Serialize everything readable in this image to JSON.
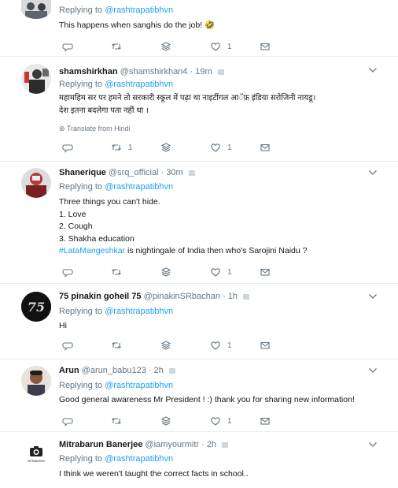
{
  "colors": {
    "accent": "#1da1f2",
    "muted": "#657786",
    "border": "#e6ecf0"
  },
  "tweets": [
    {
      "name": "",
      "handle": "",
      "time": "",
      "reply_prefix": "Replying to",
      "reply_handle": "@rashtrapatibhvn",
      "text": "This happens when sanghis do the job! 🤣",
      "reply_count": "",
      "retweet_count": "",
      "like_count": "1"
    },
    {
      "name": "shamshirkhan",
      "handle": "@shamshirkhan4",
      "time": "19m",
      "reply_prefix": "Replying to",
      "reply_handle": "@rashtrapatibhvn",
      "text_line1": "महामहिम सर पर हमने तो सरकारी स्कूल में पढ़ा था नाइटींगल आॅफ़ इंडिया सरोजिनी नायडू।",
      "text_line2": "देश इतना बदलेगा पता नहीं था ।",
      "translate": "Translate from Hindi",
      "reply_count": "",
      "retweet_count": "1",
      "like_count": "1"
    },
    {
      "name": "Shanerique",
      "handle": "@srq_official",
      "time": "30m",
      "reply_prefix": "Replying to",
      "reply_handle": "@rashtrapatibhvn",
      "lines": [
        "Three things you can't hide.",
        "1. Love",
        "2. Cough",
        "3. Shakha education"
      ],
      "hashtag": "#LataMangeshkar",
      "hashtag_rest": " is nightingale of India then who's Sarojini Naidu ?",
      "reply_count": "",
      "retweet_count": "",
      "like_count": "1"
    },
    {
      "name": "75 pinakin goheil 75",
      "handle": "@pinakinSRbachan",
      "time": "1h",
      "reply_prefix": "Replying to",
      "reply_handle": "@rashtrapatibhvn",
      "text": "Hi",
      "reply_count": "",
      "retweet_count": "",
      "like_count": "1"
    },
    {
      "name": "Arun",
      "handle": "@arun_babu123",
      "time": "2h",
      "reply_prefix": "Replying to",
      "reply_handle": "@rashtrapatibhvn",
      "text": "Good general awareness Mr President ! :) thank you for sharing new information!",
      "reply_count": "",
      "retweet_count": "",
      "like_count": "1"
    },
    {
      "name": "Mitrabarun Banerjee",
      "handle": "@iamyourmitr",
      "time": "2h",
      "reply_prefix": "Replying to",
      "reply_handle": "@rashtrapatibhvn",
      "text": "I think we weren't taught the correct facts in school..",
      "avatar_label": "MITRABARUN",
      "reply_count": "",
      "retweet_count": "",
      "like_count": ""
    }
  ]
}
